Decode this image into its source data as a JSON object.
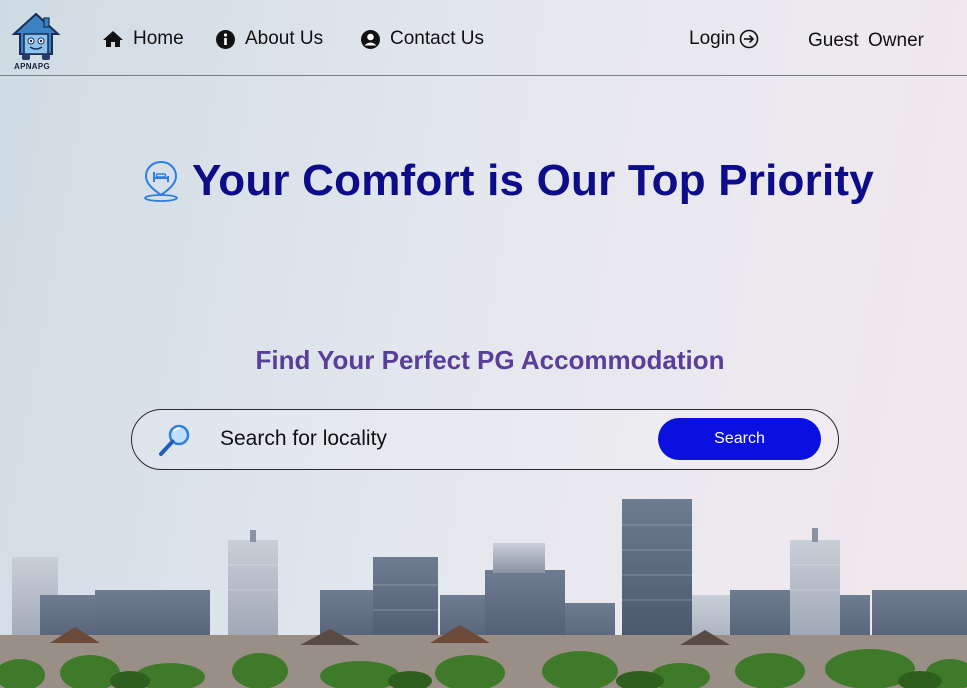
{
  "brand": {
    "logo_text": "APNAPG"
  },
  "nav": {
    "home": "Home",
    "about": "About Us",
    "contact": "Contact Us",
    "login": "Login",
    "guest": "Guest",
    "owner": "Owner"
  },
  "hero": {
    "title": "Your Comfort is Our Top Priority",
    "subtitle": "Find Your Perfect PG Accommodation"
  },
  "search": {
    "placeholder": "Search for locality",
    "button_label": "Search"
  },
  "colors": {
    "title": "#0d0d8a",
    "subtitle": "#5a3f9a",
    "search_button": "#0a10e0",
    "icon_blue": "#2f7fe0"
  }
}
